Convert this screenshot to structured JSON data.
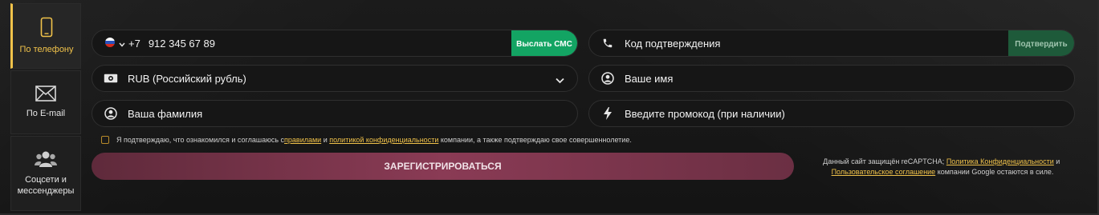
{
  "tabs": [
    {
      "label": "По телефону",
      "icon": "smartphone-icon",
      "active": true
    },
    {
      "label": "По E-mail",
      "icon": "envelope-icon",
      "active": false
    },
    {
      "label": "Соцсети и мессенджеры",
      "icon": "users-icon",
      "active": false
    }
  ],
  "phone": {
    "country_code": "+7",
    "value": "912 345 67 89",
    "send_sms_label": "Выслать СМС"
  },
  "confirm_code": {
    "placeholder": "Код подтверждения",
    "confirm_label": "Подтвердить"
  },
  "currency": {
    "value": "RUB (Российский рубль)"
  },
  "first_name": {
    "placeholder": "Ваше имя"
  },
  "last_name": {
    "placeholder": "Ваша фамилия"
  },
  "promo": {
    "placeholder": "Введите промокод (при наличии)"
  },
  "agreement": {
    "part1": "Я подтверждаю, что ознакомился и соглашаюсь с ",
    "rules_link": "правилами",
    "part2": " и ",
    "privacy_link": "политикой конфиденциальности",
    "part3": " компании, а также подтверждаю свое совершеннолетие."
  },
  "register_label": "ЗАРЕГИСТРИРОВАТЬСЯ",
  "recaptcha": {
    "part1": "Данный сайт защищён reCAPTCHA; ",
    "privacy_link": "Политика Конфиденциальности",
    "part2": " и ",
    "terms_link": "Пользовательское соглашение",
    "part3": " компании Google остаются в силе."
  },
  "colors": {
    "accent": "#f0c24a",
    "sms_button": "#13a463",
    "register_button": "#8a3b55"
  }
}
